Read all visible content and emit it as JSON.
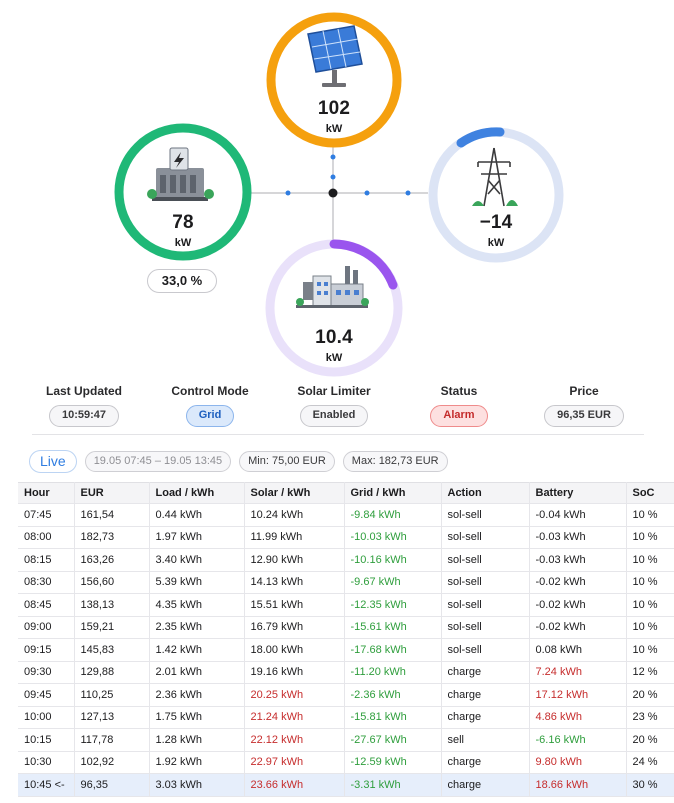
{
  "flow": {
    "solar": {
      "value": "102",
      "unit": "kW",
      "icon": "solar-panel-icon",
      "color": "#f5a00e"
    },
    "battery": {
      "value": "78",
      "unit": "kW",
      "icon": "battery-station-icon",
      "color": "#1fb877",
      "soc": "33,0 %"
    },
    "grid": {
      "value": "−14",
      "unit": "kW",
      "icon": "power-pylon-icon",
      "color": "#3f82e0"
    },
    "load": {
      "value": "10.4",
      "unit": "kW",
      "icon": "factory-icon",
      "color": "#9a55ee"
    }
  },
  "summary": {
    "last_updated": {
      "label": "Last Updated",
      "value": "10:59:47"
    },
    "control_mode": {
      "label": "Control Mode",
      "value": "Grid"
    },
    "solar_limiter": {
      "label": "Solar Limiter",
      "value": "Enabled"
    },
    "status": {
      "label": "Status",
      "value": "Alarm"
    },
    "price": {
      "label": "Price",
      "value": "96,35 EUR"
    }
  },
  "filters": {
    "live": "Live",
    "range": "19.05 07:45 – 19.05 13:45",
    "min": "Min: 75,00 EUR",
    "max": "Max: 182,73 EUR"
  },
  "table": {
    "columns": [
      "Hour",
      "EUR",
      "Load / kWh",
      "Solar / kWh",
      "Grid / kWh",
      "Action",
      "Battery",
      "SoC"
    ],
    "rows": [
      [
        "07:45",
        "161,54",
        "0.44 kWh",
        "10.24 kWh",
        "-9.84 kWh",
        "sol-sell",
        "-0.04 kWh",
        "10 %"
      ],
      [
        "08:00",
        "182,73",
        "1.97 kWh",
        "11.99 kWh",
        "-10.03 kWh",
        "sol-sell",
        "-0.03 kWh",
        "10 %"
      ],
      [
        "08:15",
        "163,26",
        "3.40 kWh",
        "12.90 kWh",
        "-10.16 kWh",
        "sol-sell",
        "-0.03 kWh",
        "10 %"
      ],
      [
        "08:30",
        "156,60",
        "5.39 kWh",
        "14.13 kWh",
        "-9.67 kWh",
        "sol-sell",
        "-0.02 kWh",
        "10 %"
      ],
      [
        "08:45",
        "138,13",
        "4.35 kWh",
        "15.51 kWh",
        "-12.35 kWh",
        "sol-sell",
        "-0.02 kWh",
        "10 %"
      ],
      [
        "09:00",
        "159,21",
        "2.35 kWh",
        "16.79 kWh",
        "-15.61 kWh",
        "sol-sell",
        "-0.02 kWh",
        "10 %"
      ],
      [
        "09:15",
        "145,83",
        "1.42 kWh",
        "18.00 kWh",
        "-17.68 kWh",
        "sol-sell",
        "0.08 kWh",
        "10 %"
      ],
      [
        "09:30",
        "129,88",
        "2.01 kWh",
        "19.16 kWh",
        "-11.20 kWh",
        "charge",
        "7.24 kWh",
        "12 %"
      ],
      [
        "09:45",
        "110,25",
        "2.36 kWh",
        "20.25 kWh",
        "-2.36 kWh",
        "charge",
        "17.12 kWh",
        "20 %"
      ],
      [
        "10:00",
        "127,13",
        "1.75 kWh",
        "21.24 kWh",
        "-15.81 kWh",
        "charge",
        "4.86 kWh",
        "23 %"
      ],
      [
        "10:15",
        "117,78",
        "1.28 kWh",
        "22.12 kWh",
        "-27.67 kWh",
        "sell",
        "-6.16 kWh",
        "20 %"
      ],
      [
        "10:30",
        "102,92",
        "1.92 kWh",
        "22.97 kWh",
        "-12.59 kWh",
        "charge",
        "9.80 kWh",
        "24 %"
      ],
      [
        "10:45 <-",
        "96,35",
        "3.03 kWh",
        "23.66 kWh",
        "-3.31 kWh",
        "charge",
        "18.66 kWh",
        "30 %"
      ]
    ],
    "current_row": 12,
    "colors": {
      "negative": "#2f9e3d",
      "positive": "#c62d2d",
      "highlight": "#e6eefb"
    }
  }
}
